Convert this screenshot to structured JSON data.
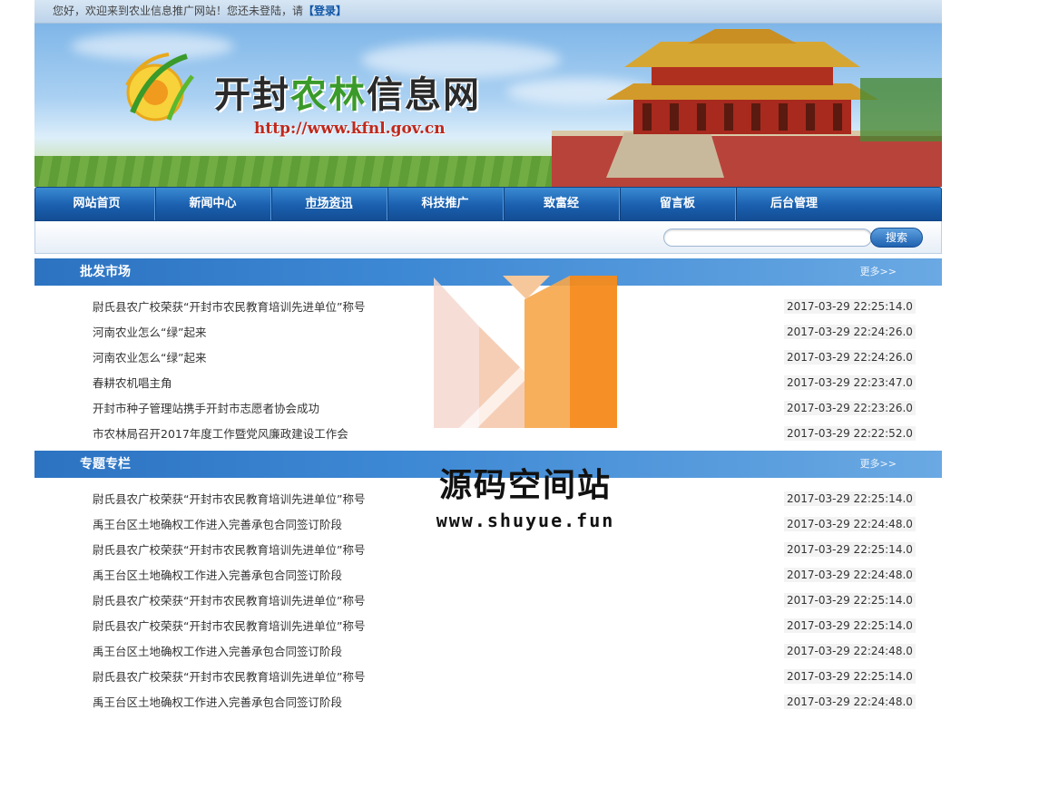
{
  "topbar": {
    "greeting": "您好，欢迎来到农业信息推广网站！您还未登陆，请",
    "login_label": "【登录】"
  },
  "banner": {
    "site_name_part1": "开封",
    "site_name_part2": "农林",
    "site_name_part3": "信息网",
    "site_url": "http://www.kfnl.gov.cn"
  },
  "nav": {
    "items": [
      "网站首页",
      "新闻中心",
      "市场资讯",
      "科技推广",
      "致富经",
      "留言板",
      "后台管理"
    ]
  },
  "search": {
    "placeholder": "",
    "button_label": "搜索"
  },
  "sections": [
    {
      "title": "批发市场",
      "more": "更多>>",
      "items": [
        {
          "title": "尉氏县农广校荣获“开封市农民教育培训先进单位”称号",
          "time": "2017-03-29 22:25:14.0"
        },
        {
          "title": "河南农业怎么“绿”起来",
          "time": "2017-03-29 22:24:26.0"
        },
        {
          "title": "河南农业怎么“绿”起来",
          "time": "2017-03-29 22:24:26.0"
        },
        {
          "title": "春耕农机唱主角",
          "time": "2017-03-29 22:23:47.0"
        },
        {
          "title": "开封市种子管理站携手开封市志愿者协会成功",
          "time": "2017-03-29 22:23:26.0"
        },
        {
          "title": "市农林局召开2017年度工作暨党风廉政建设工作会",
          "time": "2017-03-29 22:22:52.0"
        }
      ]
    },
    {
      "title": "专题专栏",
      "more": "更多>>",
      "items": [
        {
          "title": "尉氏县农广校荣获“开封市农民教育培训先进单位”称号",
          "time": "2017-03-29 22:25:14.0"
        },
        {
          "title": "禹王台区土地确权工作进入完善承包合同签订阶段",
          "time": "2017-03-29 22:24:48.0"
        },
        {
          "title": "尉氏县农广校荣获“开封市农民教育培训先进单位”称号",
          "time": "2017-03-29 22:25:14.0"
        },
        {
          "title": "禹王台区土地确权工作进入完善承包合同签订阶段",
          "time": "2017-03-29 22:24:48.0"
        },
        {
          "title": "尉氏县农广校荣获“开封市农民教育培训先进单位”称号",
          "time": "2017-03-29 22:25:14.0"
        },
        {
          "title": "尉氏县农广校荣获“开封市农民教育培训先进单位”称号",
          "time": "2017-03-29 22:25:14.0"
        },
        {
          "title": "禹王台区土地确权工作进入完善承包合同签订阶段",
          "time": "2017-03-29 22:24:48.0"
        },
        {
          "title": "尉氏县农广校荣获“开封市农民教育培训先进单位”称号",
          "time": "2017-03-29 22:25:14.0"
        },
        {
          "title": "禹王台区土地确权工作进入完善承包合同签订阶段",
          "time": "2017-03-29 22:24:48.0"
        }
      ]
    }
  ],
  "watermark": {
    "text": "源码空间站",
    "url": "www.shuyue.fun"
  }
}
